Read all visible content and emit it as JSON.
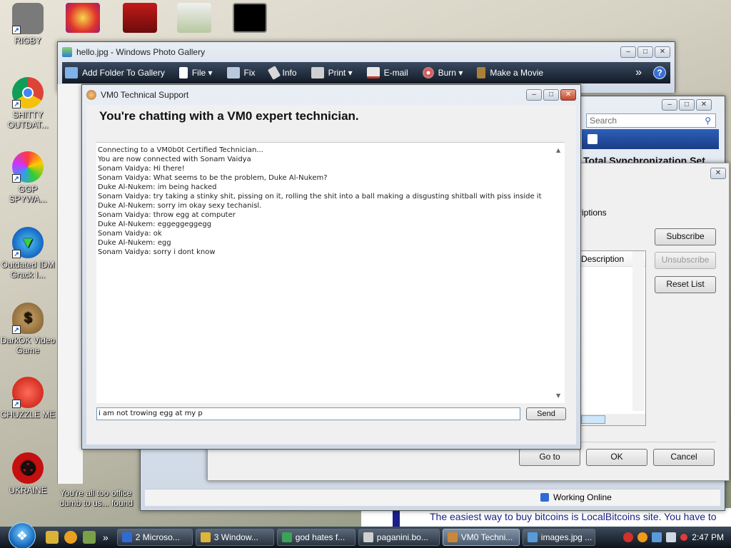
{
  "desktop": {
    "left_icons": [
      {
        "label": "RIGBY"
      },
      {
        "label": "SHITTY OUTDAT..."
      },
      {
        "label": "GGP SPYWA..."
      },
      {
        "label": "Outdated IDM Grack I..."
      },
      {
        "label": "DarkOK Video Game"
      },
      {
        "label": "CHUZZLE ME"
      },
      {
        "label": "UKRAINE"
      }
    ],
    "bottom_texts": [
      "You're all too dumb to us...",
      "office found"
    ],
    "web_text": "The easiest way to buy bitcoins is LocalBitcoins site. You have to"
  },
  "photo_gallery": {
    "title": "hello.jpg - Windows Photo Gallery",
    "toolbar": [
      "Add Folder To Gallery",
      "File",
      "Fix",
      "Info",
      "Print",
      "E-mail",
      "Burn",
      "Make a Movie"
    ],
    "more": "»",
    "help": "?"
  },
  "back_window": {
    "search_placeholder": "Search",
    "header_text": "Total   Synchronization Set",
    "status": "Working Online"
  },
  "subscriptions_dialog": {
    "partial_label": "riptions",
    "column": "Description",
    "buttons": {
      "subscribe": "Subscribe",
      "unsubscribe": "Unsubscribe",
      "reset": "Reset List"
    },
    "goto": "Go to",
    "ok": "OK",
    "cancel": "Cancel"
  },
  "chat": {
    "title": "VM0 Technical Support",
    "heading": "You're chatting with a VM0 expert technician.",
    "messages": [
      "Connecting to a VM0b0t Certified Technician...",
      "You are now connected with Sonam Vaidya",
      "Sonam Vaidya: Hi there!",
      "Sonam Vaidya: What seems to be the problem, Duke Al-Nukem?",
      "Duke Al-Nukem: im being hacked",
      "Sonam Vaidya: try taking a stinky shit, pissing on it, rolling the shit into a ball making a disgusting shitball with piss inside it",
      "Duke Al-Nukem: sorry im okay sexy techanisl.",
      "Sonam Vaidya: throw egg at computer",
      "Duke Al-Nukem: eggeggeggegg",
      "Sonam Vaidya: ok",
      "Duke Al-Nukem: egg",
      "Sonam Vaidya: sorry i dont know"
    ],
    "input_value": "i am not trowing egg at my p",
    "send": "Send"
  },
  "taskbar": {
    "buttons": [
      {
        "label": "2 Microso..."
      },
      {
        "label": "3 Window..."
      },
      {
        "label": "god hates f..."
      },
      {
        "label": "paganini.bo..."
      },
      {
        "label": "VM0 Techni...",
        "active": true
      },
      {
        "label": "images.jpg ..."
      }
    ],
    "clock": "2:47 PM",
    "chevron": "»"
  },
  "colors": {
    "taskbar": "#1a2330",
    "vista_blue": "#1c4ea8",
    "close_red": "#c2472b"
  }
}
